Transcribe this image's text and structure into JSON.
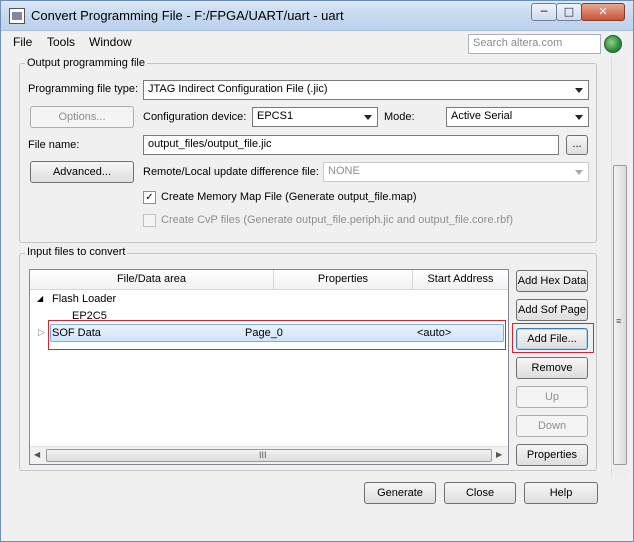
{
  "window": {
    "title": "Convert Programming File - F:/FPGA/UART/uart - uart",
    "controls": {
      "minimize": "─",
      "maximize": "□",
      "close": "✕"
    }
  },
  "menubar": {
    "items": [
      "File",
      "Tools",
      "Window"
    ]
  },
  "search": {
    "placeholder": "Search altera.com"
  },
  "output_group": {
    "title": "Output programming file",
    "programming_file_type_label": "Programming file type:",
    "programming_file_type_value": "JTAG Indirect Configuration File (.jic)",
    "options_button": "Options...",
    "configuration_device_label": "Configuration device:",
    "configuration_device_value": "EPCS1",
    "mode_label": "Mode:",
    "mode_value": "Active Serial",
    "file_name_label": "File name:",
    "file_name_value": "output_files/output_file.jic",
    "browse_button": "...",
    "advanced_button": "Advanced...",
    "remote_local_label": "Remote/Local update difference file:",
    "remote_local_value": "NONE",
    "create_map_label": "Create Memory Map File (Generate output_file.map)",
    "create_map_checked": true,
    "create_cvp_label": "Create CvP files (Generate output_file.periph.jic and output_file.core.rbf)",
    "create_cvp_checked": false
  },
  "input_group": {
    "title": "Input files to convert",
    "columns": [
      "File/Data area",
      "Properties",
      "Start Address"
    ],
    "tree": {
      "flash_loader": "Flash Loader",
      "flash_loader_child": "EP2C5",
      "sof_data": {
        "area": "SOF Data",
        "properties": "Page_0",
        "start_address": "<auto>"
      }
    },
    "scroll_grip": "III",
    "buttons": {
      "add_hex_data": "Add Hex Data",
      "add_sof_page": "Add Sof Page",
      "add_file": "Add File...",
      "remove": "Remove",
      "up": "Up",
      "down": "Down",
      "properties": "Properties"
    }
  },
  "footer": {
    "generate": "Generate",
    "close": "Close",
    "help": "Help"
  },
  "icons": {
    "app": "app-icon",
    "expand_open": "triangle-down-icon",
    "expand_closed": "triangle-right-icon",
    "globe": "globe-icon",
    "vscroll_grip": "grip-icon"
  },
  "colors": {
    "highlight_box": "#e0202a",
    "selection": "#cfe4fb"
  }
}
